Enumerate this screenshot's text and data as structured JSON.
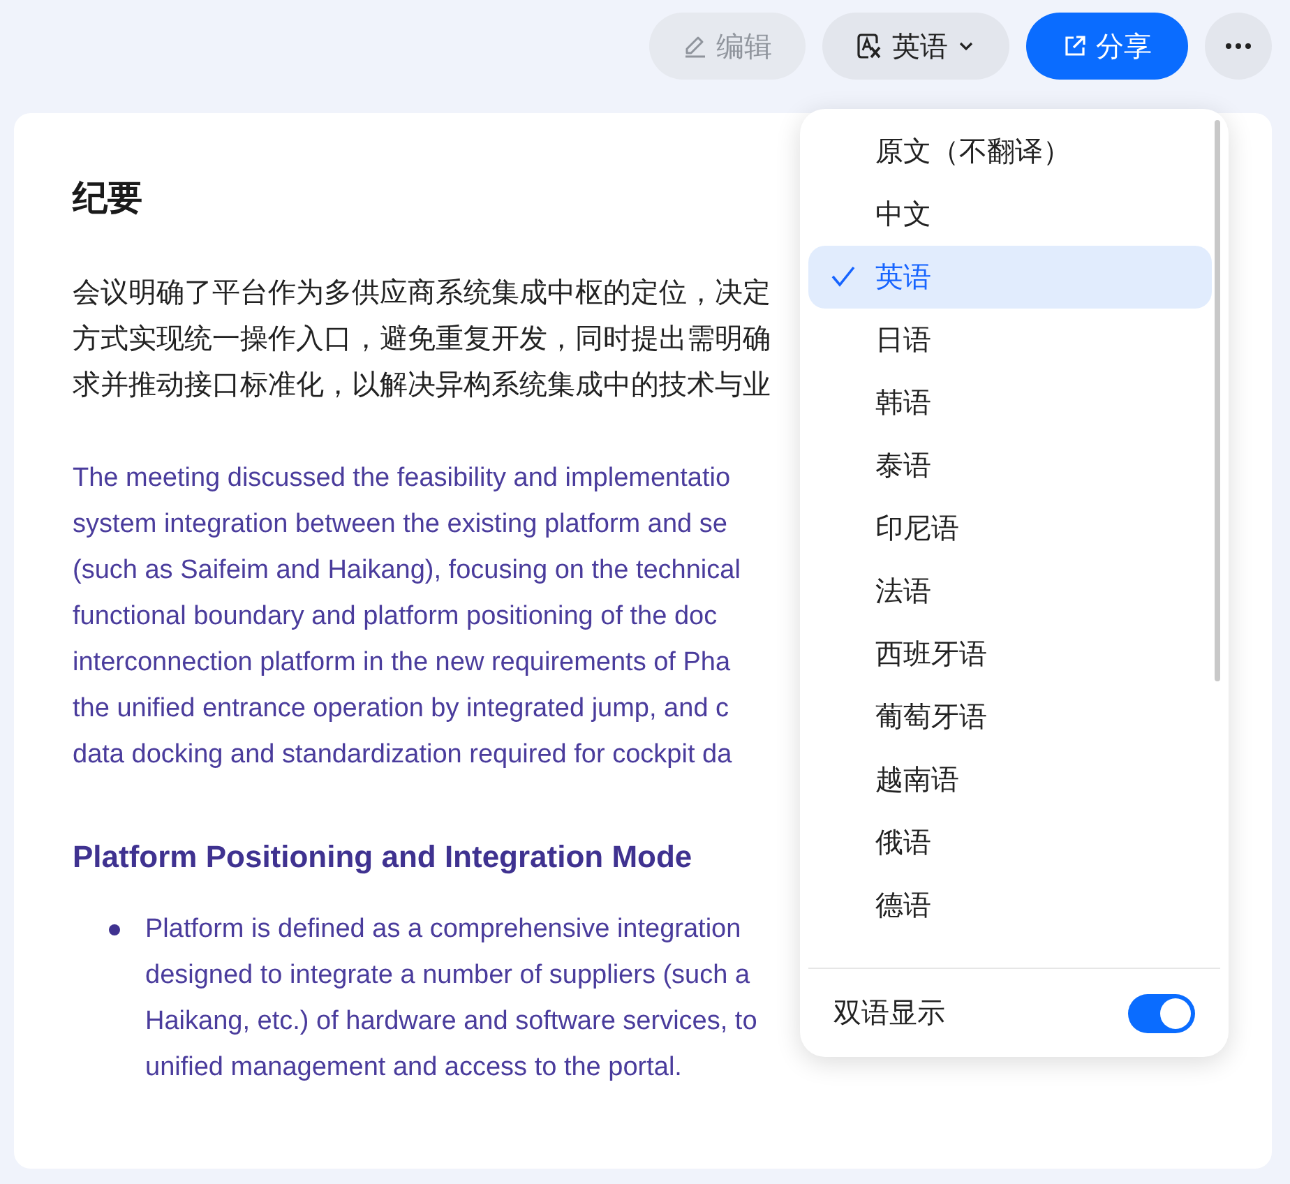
{
  "toolbar": {
    "edit_button": {
      "label": "编辑",
      "disabled": true
    },
    "language_button": {
      "label": "英语"
    },
    "share_button": {
      "label": "分享"
    }
  },
  "document": {
    "title": "纪要",
    "summary_lines": [
      "会议明确了平台作为多供应商系统集成中枢的定位，决定",
      "方式实现统一操作入口，避免重复开发，同时提出需明确",
      "求并推动接口标准化，以解决异构系统集成中的技术与业"
    ],
    "translation_lines": [
      "The meeting discussed the feasibility and implementatio",
      "system integration between the existing platform and se",
      "(such as Saifeim and Haikang), focusing on the technical",
      "functional boundary and platform positioning of the doc",
      "interconnection platform in the new requirements of Pha",
      "the unified entrance operation by integrated jump, and c",
      "data docking and standardization required for cockpit da"
    ],
    "sections": [
      {
        "heading": "Platform Positioning and Integration Mode",
        "bullets": [
          {
            "lines": [
              "Platform is defined as a comprehensive integration",
              "designed to integrate a number of suppliers (such a",
              "Haikang, etc.) of hardware and software services, to",
              "unified management and access to the portal."
            ]
          }
        ]
      }
    ]
  },
  "language_menu": {
    "options": [
      {
        "label": "原文（不翻译）",
        "selected": false
      },
      {
        "label": "中文",
        "selected": false
      },
      {
        "label": "英语",
        "selected": true
      },
      {
        "label": "日语",
        "selected": false
      },
      {
        "label": "韩语",
        "selected": false
      },
      {
        "label": "泰语",
        "selected": false
      },
      {
        "label": "印尼语",
        "selected": false
      },
      {
        "label": "法语",
        "selected": false
      },
      {
        "label": "西班牙语",
        "selected": false
      },
      {
        "label": "葡萄牙语",
        "selected": false
      },
      {
        "label": "越南语",
        "selected": false
      },
      {
        "label": "俄语",
        "selected": false
      },
      {
        "label": "德语",
        "selected": false
      }
    ],
    "bilingual": {
      "label": "双语显示",
      "on": true
    }
  }
}
